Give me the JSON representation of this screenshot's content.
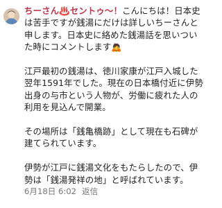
{
  "comment": {
    "author": "ちーさん♨️セントゥ〜！",
    "intro": "こんにちは！日本史は苦手ですが銭湯にだけは詳しいちーさんと申します。日本史に絡めた銭湯話を思いついた時にコメントします🙇",
    "paragraphs": [
      "江戸最初の銭湯は、徳川家康が江戸入城した翌年1591年でした。現在の日本橋付近に伊勢出身の与市という人物が、労働に疲れた人の利用を見込んで開業。",
      "その場所は「銭亀橋跡」として現在も石碑が建てられています。",
      "伊勢が江戸に銭湯文化をもたらしたので、伊勢は「銭湯発祥の地」と呼ばれています。"
    ],
    "date": "6月18日 6:02",
    "reply_label": "返信",
    "avatar_icon": "user-avatar-photo"
  },
  "colors": {
    "author": "#c2334d",
    "text": "#222222",
    "meta": "#777777"
  }
}
